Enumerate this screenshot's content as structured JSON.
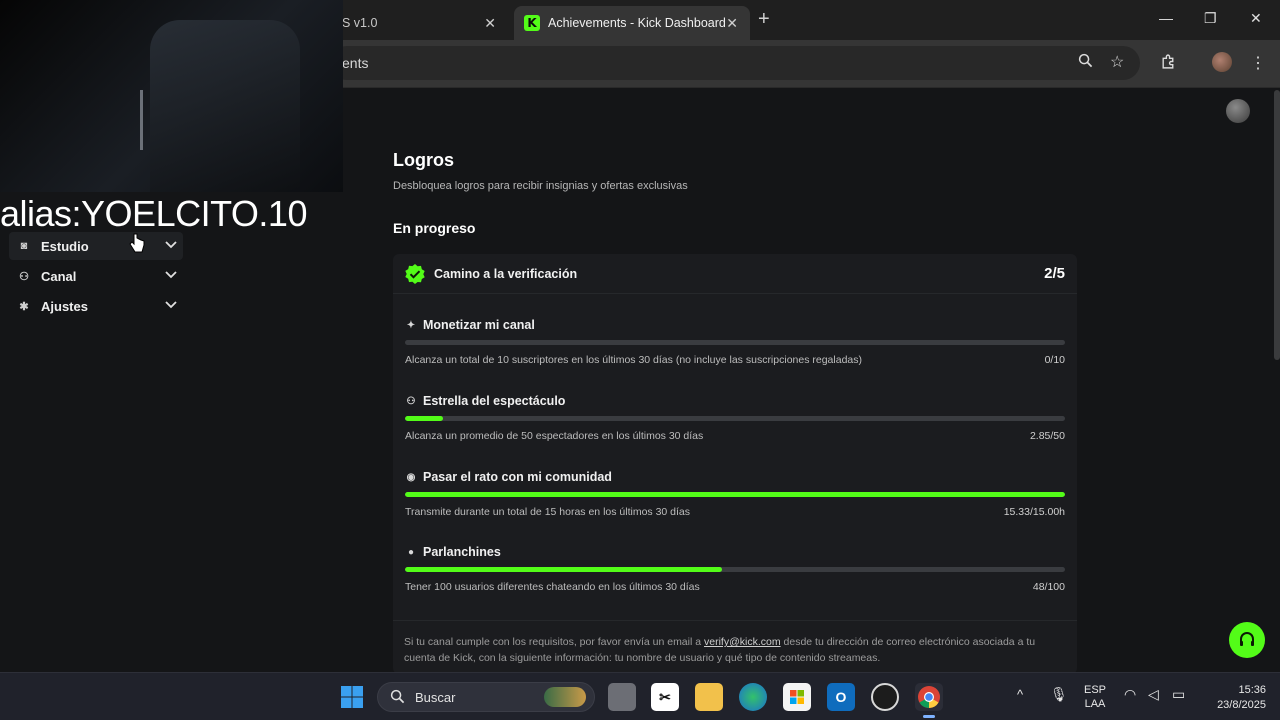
{
  "browser": {
    "tabs": [
      {
        "label": "S v1.0",
        "active": false
      },
      {
        "label": "Achievements - Kick Dashboard",
        "active": true
      }
    ],
    "favicon_letter": "K",
    "new_tab": "+",
    "url_fragment": "ents"
  },
  "overlay": {
    "alias": "alias:YOELCITO.10"
  },
  "sidebar": {
    "items": [
      {
        "label": "Estudio",
        "icon": "studio-icon"
      },
      {
        "label": "Canal",
        "icon": "users-icon"
      },
      {
        "label": "Ajustes",
        "icon": "gear-icon"
      }
    ]
  },
  "page": {
    "title": "Logros",
    "subtitle": "Desbloquea logros para recibir insignias y ofertas exclusivas",
    "section": "En progreso"
  },
  "card": {
    "title": "Camino a la verificación",
    "count": "2/5",
    "achievements": [
      {
        "name": "Monetizar mi canal",
        "icon": "sparkle-icon",
        "desc": "Alcanza un total de 10 suscriptores en los últimos 30 días (no incluye las suscripciones regaladas)",
        "progress": "0/10",
        "fraction": 0
      },
      {
        "name": "Estrella del espectáculo",
        "icon": "users-icon",
        "desc": "Alcanza un promedio de 50 espectadores en los últimos 30 días",
        "progress": "2.85/50",
        "fraction": 0.057
      },
      {
        "name": "Pasar el rato con mi comunidad",
        "icon": "broadcast-icon",
        "desc": "Transmite durante un total de 15 horas en los últimos 30 días",
        "progress": "15.33/15.00h",
        "fraction": 1
      },
      {
        "name": "Parlanchines",
        "icon": "chat-icon",
        "desc": "Tener 100 usuarios diferentes chateando en los últimos 30 días",
        "progress": "48/100",
        "fraction": 0.48
      }
    ],
    "note_before": "Si tu canal cumple con los requisitos, por favor envía un email a ",
    "note_link": "verify@kick.com",
    "note_after": " desde tu dirección de correo electrónico asociada a tu cuenta de Kick, con la siguiente información: tu nombre de usuario y qué tipo de contenido streameas."
  },
  "taskbar": {
    "search_label": "Buscar",
    "lang": "ESP",
    "lang_sub": "LAA",
    "time": "15:36",
    "date": "23/8/2025"
  },
  "colors": {
    "accent": "#53fc18",
    "background": "#141517",
    "card": "#1b1c1f"
  }
}
